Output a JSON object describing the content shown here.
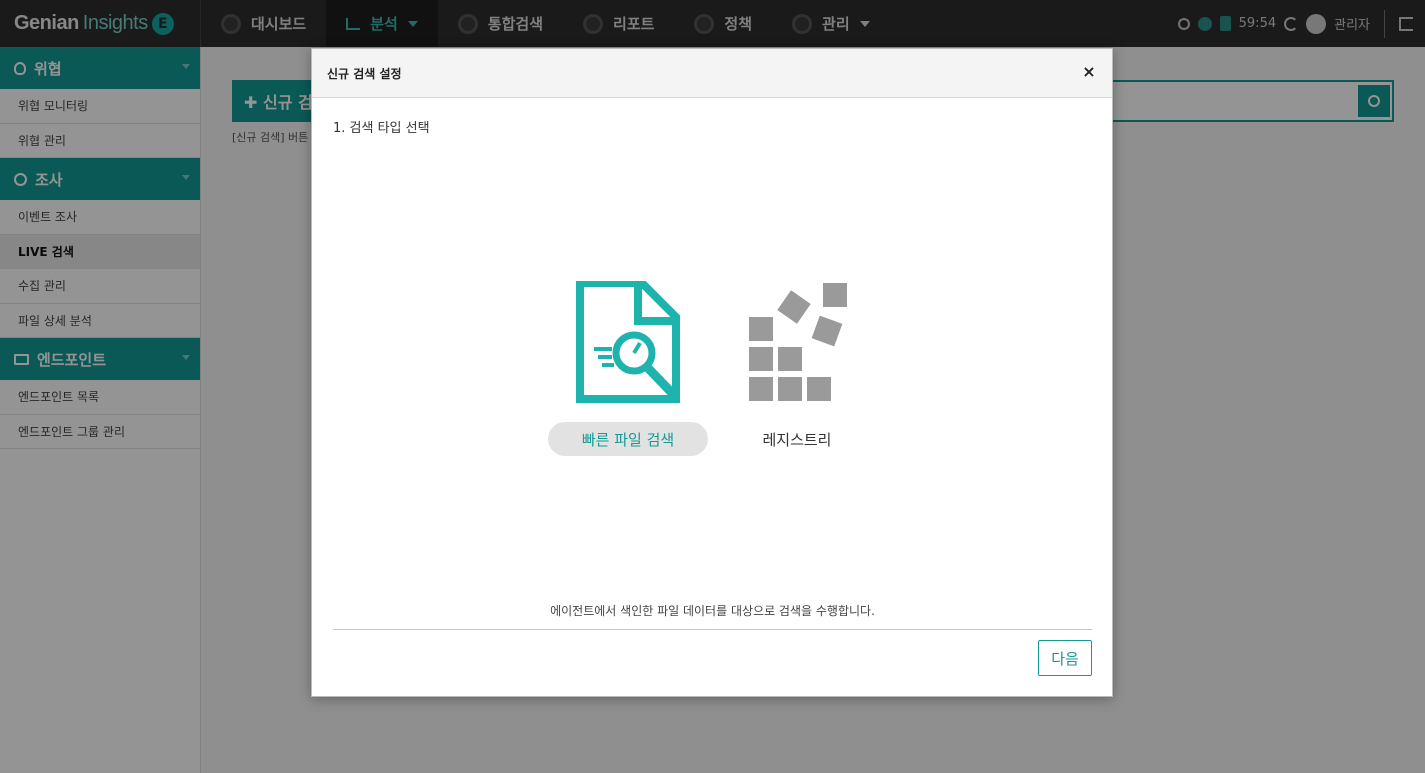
{
  "brand": {
    "name": "Genian",
    "product": "Insights",
    "logo_letter": "E"
  },
  "nav": [
    {
      "label": "대시보드",
      "active": false
    },
    {
      "label": "분석",
      "active": true
    },
    {
      "label": "통합검색",
      "active": false
    },
    {
      "label": "리포트",
      "active": false
    },
    {
      "label": "정책",
      "active": false
    },
    {
      "label": "관리",
      "active": false
    }
  ],
  "topbar": {
    "timer": "59:54",
    "user": "관리자"
  },
  "sidebar": {
    "sections": [
      {
        "title": "위협",
        "icon": "bug-icon",
        "items": [
          "위협 모니터링",
          "위협 관리"
        ]
      },
      {
        "title": "조사",
        "icon": "search-icon",
        "items": [
          "이벤트 조사",
          "LIVE 검색",
          "수집 관리",
          "파일 상세 분석"
        ]
      },
      {
        "title": "엔드포인트",
        "icon": "monitor-icon",
        "items": [
          "엔드포인트 목록",
          "엔드포인트 그룹 관리"
        ]
      }
    ],
    "active_item": "LIVE 검색"
  },
  "content": {
    "new_button": "✚ 신규 검색",
    "hint": "[신규 검색] 버튼"
  },
  "modal": {
    "title": "신규 검색 설정",
    "close": "×",
    "step": "1. 검색 타입 선택",
    "options": [
      {
        "label": "빠른 파일 검색",
        "icon": "file-search-icon",
        "selected": true
      },
      {
        "label": "레지스트리",
        "icon": "registry-blocks-icon",
        "selected": false
      }
    ],
    "description": "에이전트에서 색인한 파일 데이터를 대상으로 검색을 수행합니다.",
    "next_button": "다음"
  },
  "colors": {
    "accent": "#139a94",
    "topbar": "#2d2d2d",
    "icon_teal": "#1fb3ad",
    "icon_gray": "#9a9a9a"
  }
}
